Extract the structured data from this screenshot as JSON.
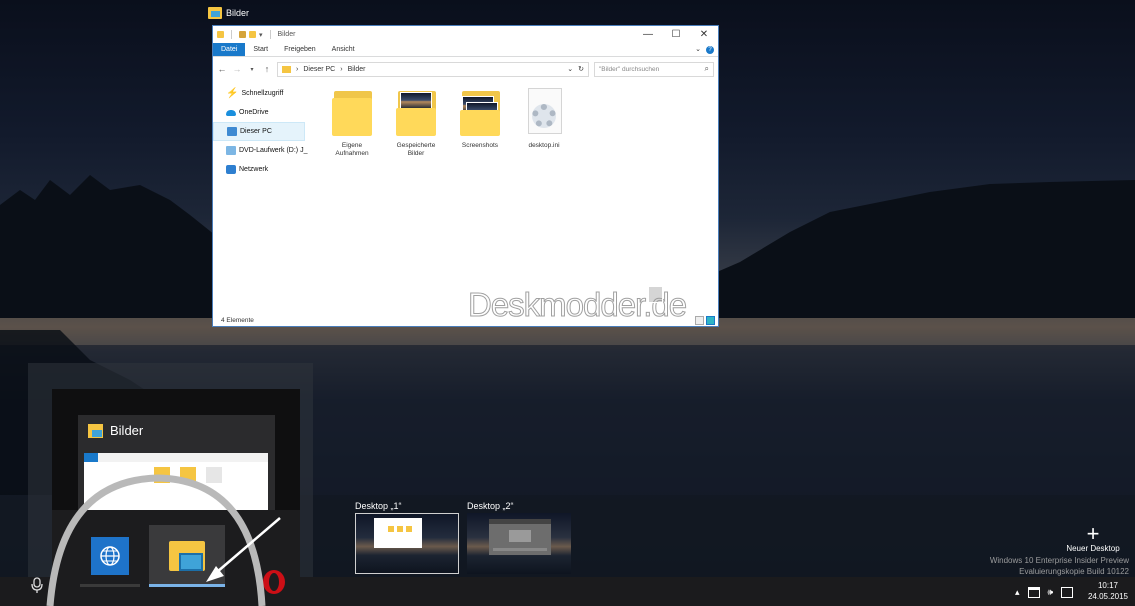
{
  "window": {
    "caption_title": "Bilder",
    "titlebar_text": "Bilder",
    "controls": {
      "minimize": "—",
      "maximize": "☐",
      "close": "✕"
    },
    "ribbon_tabs": [
      "Datei",
      "Start",
      "Freigeben",
      "Ansicht"
    ],
    "address_path": [
      "Dieser PC",
      "Bilder"
    ],
    "search_placeholder": "\"Bilder\" durchsuchen",
    "nav_items": [
      {
        "label": "Schnellzugriff",
        "icon": "lightning-star-icon"
      },
      {
        "label": "OneDrive",
        "icon": "cloud-icon"
      },
      {
        "label": "Dieser PC",
        "icon": "computer-icon"
      },
      {
        "label": "DVD-Laufwerk (D:) J_",
        "icon": "dvd-drive-icon"
      },
      {
        "label": "Netzwerk",
        "icon": "network-icon"
      }
    ],
    "files": [
      {
        "label_line1": "Eigene",
        "label_line2": "Aufnahmen",
        "icon": "folder-icon"
      },
      {
        "label_line1": "Gespeicherte",
        "label_line2": "Bilder",
        "icon": "folder-photo-icon"
      },
      {
        "label_line1": "Screenshots",
        "label_line2": "",
        "icon": "folder-photo-icon"
      },
      {
        "label_line1": "desktop.ini",
        "label_line2": "",
        "icon": "settings-file-icon"
      }
    ],
    "status_text": "4 Elemente"
  },
  "watermark": "Deskmodder.de",
  "virtual_desktops": [
    {
      "label": "Desktop „1“",
      "active": true
    },
    {
      "label": "Desktop „2“",
      "active": false
    }
  ],
  "new_desktop": {
    "label": "Neuer Desktop"
  },
  "build_info": {
    "line1": "Windows 10 Enterprise Insider Preview",
    "line2": "Evaluierungskopie Build 10122"
  },
  "preview": {
    "title": "Bilder"
  },
  "tray": {
    "time": "10:17",
    "date": "24.05.2015"
  },
  "colors": {
    "accent": "#1979ca",
    "folder": "#f5c542",
    "taskbar": "#1b1b1d"
  }
}
